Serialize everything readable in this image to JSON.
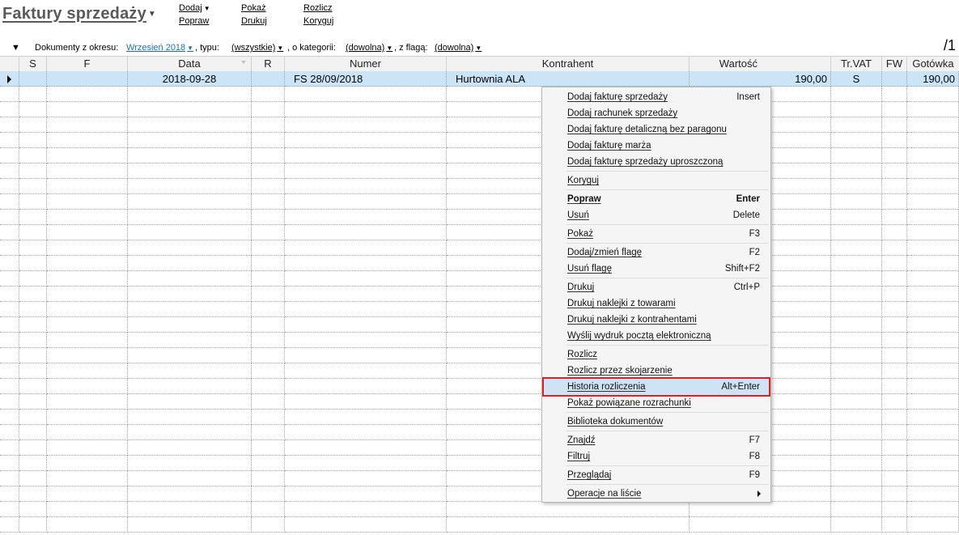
{
  "header": {
    "title": "Faktury sprzedaży",
    "menu": {
      "dodaj": "Dodaj",
      "popraw": "Popraw",
      "pokaz": "Pokaż",
      "drukuj": "Drukuj",
      "rozlicz": "Rozlicz",
      "koryguj": "Koryguj"
    },
    "page_count": "/1"
  },
  "filter": {
    "period_label": "Dokumenty z okresu:",
    "period_value": "Wrzesień 2018",
    "type_label": ", typu:",
    "type_value": "(wszystkie)",
    "category_label": ", o kategorii:",
    "category_value": "(dowolna)",
    "flag_label": ", z flagą:",
    "flag_value": "(dowolna)"
  },
  "table": {
    "columns": [
      "S",
      "F",
      "Data",
      "R",
      "Numer",
      "Kontrahent",
      "Wartość",
      "Tr.VAT",
      "FW",
      "Gotówka"
    ],
    "rows": [
      {
        "s": "",
        "f": "",
        "data": "2018-09-28",
        "r": "",
        "numer": "FS 28/09/2018",
        "kontrahent": "Hurtownia ALA",
        "wartosc": "190,00",
        "trvat": "S",
        "fw": "",
        "gotowka": "190,00"
      }
    ]
  },
  "context_menu": {
    "items": [
      {
        "label": "Dodaj fakturę sprzedaży",
        "shortcut": "Insert"
      },
      {
        "label": "Dodaj rachunek sprzedaży",
        "shortcut": ""
      },
      {
        "label": "Dodaj fakturę detaliczną bez paragonu",
        "shortcut": ""
      },
      {
        "label": "Dodaj fakturę marża",
        "shortcut": ""
      },
      {
        "label": "Dodaj fakturę sprzedaży uproszczoną",
        "shortcut": ""
      },
      {
        "label": "Koryguj",
        "shortcut": ""
      },
      {
        "label": "Popraw",
        "shortcut": "Enter"
      },
      {
        "label": "Usuń",
        "shortcut": "Delete"
      },
      {
        "label": "Pokaż",
        "shortcut": "F3"
      },
      {
        "label": "Dodaj/zmień flagę",
        "shortcut": "F2"
      },
      {
        "label": "Usuń flagę",
        "shortcut": "Shift+F2"
      },
      {
        "label": "Drukuj",
        "shortcut": "Ctrl+P"
      },
      {
        "label": "Drukuj naklejki z towarami",
        "shortcut": ""
      },
      {
        "label": "Drukuj naklejki z kontrahentami",
        "shortcut": ""
      },
      {
        "label": "Wyślij wydruk pocztą elektroniczną",
        "shortcut": ""
      },
      {
        "label": "Rozlicz",
        "shortcut": ""
      },
      {
        "label": "Rozlicz przez skojarzenie",
        "shortcut": ""
      },
      {
        "label": "Historia rozliczenia",
        "shortcut": "Alt+Enter"
      },
      {
        "label": "Pokaż powiązane rozrachunki",
        "shortcut": ""
      },
      {
        "label": "Biblioteka dokumentów",
        "shortcut": ""
      },
      {
        "label": "Znajdź",
        "shortcut": "F7"
      },
      {
        "label": "Filtruj",
        "shortcut": "F8"
      },
      {
        "label": "Przeglądaj",
        "shortcut": "F9"
      },
      {
        "label": "Operacje na liście",
        "shortcut": ""
      }
    ]
  }
}
